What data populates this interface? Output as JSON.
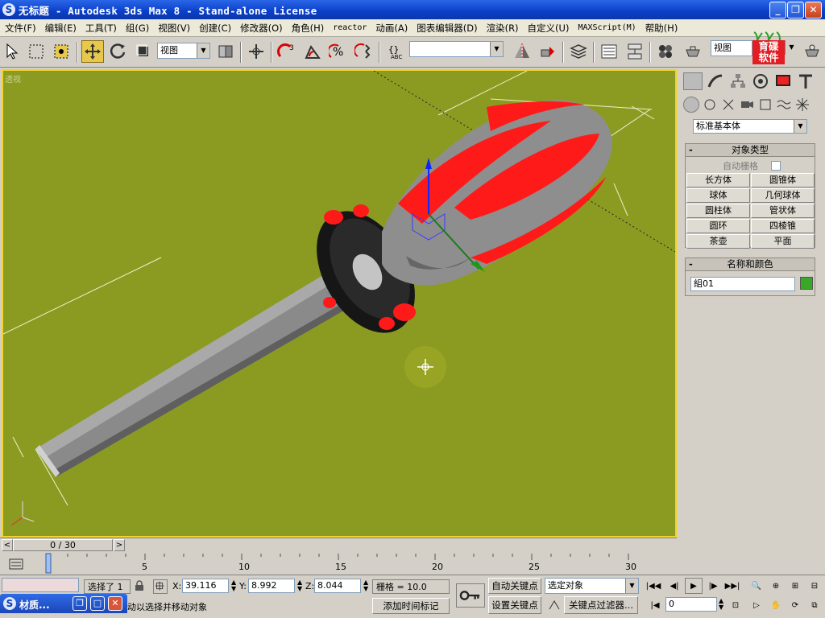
{
  "window": {
    "title": "无标题  - Autodesk 3ds Max 8  - Stand-alone License",
    "minimize_glyph": "_",
    "restore_glyph": "❐",
    "close_glyph": "✕"
  },
  "menu": [
    {
      "label": "文件(F)"
    },
    {
      "label": "编辑(E)"
    },
    {
      "label": "工具(T)"
    },
    {
      "label": "组(G)"
    },
    {
      "label": "视图(V)"
    },
    {
      "label": "创建(C)"
    },
    {
      "label": "修改器(O)"
    },
    {
      "label": "角色(H)"
    },
    {
      "label": "reactor"
    },
    {
      "label": "动画(A)"
    },
    {
      "label": "图表编辑器(D)"
    },
    {
      "label": "渲染(R)"
    },
    {
      "label": "自定义(U)"
    },
    {
      "label": "MAXScript(M)"
    },
    {
      "label": "帮助(H)"
    }
  ],
  "toolbar": {
    "coord_system": "视图",
    "named_selection": "",
    "right_view": "视图",
    "logo_text": "育碟\n软件"
  },
  "viewport": {
    "label": "透视",
    "bg_color": "#8b9b22",
    "model_colors": {
      "grey": "#8e8e8e",
      "red": "#ff1a1a"
    }
  },
  "command_panel": {
    "dropdown": "标准基本体",
    "object_type": {
      "title": "对象类型",
      "collapse": "-",
      "autogrid": "自动栅格",
      "buttons": [
        "长方体",
        "圆锥体",
        "球体",
        "几何球体",
        "圆柱体",
        "管状体",
        "圆环",
        "四棱锥",
        "茶壶",
        "平面"
      ]
    },
    "name_color": {
      "title": "名称和颜色",
      "collapse": "-",
      "name": "組01",
      "swatch": "#39a829"
    }
  },
  "timeline": {
    "frame_display": "0 / 30",
    "left_arrow": "<",
    "right_arrow": ">",
    "ticks": [
      "0",
      "5",
      "10",
      "15",
      "20",
      "25",
      "30"
    ],
    "current_frame": 0,
    "total_frames": 30
  },
  "status": {
    "selected": "选择了 1",
    "x_label": "X:",
    "x_value": "39.116",
    "y_label": "Y:",
    "y_value": "8.992",
    "z_label": "Z:",
    "z_value": "8.044",
    "grid": "栅格 = 10.0",
    "prompt": "动以选择并移动对象",
    "add_time_tag": "添加时间标记",
    "autokey": "自动关键点",
    "setkey": "设置关键点",
    "selection_set": "选定对象",
    "key_filters": "关键点过滤器...",
    "frame_field": "0"
  },
  "minimized_window": {
    "title": "材质..."
  }
}
